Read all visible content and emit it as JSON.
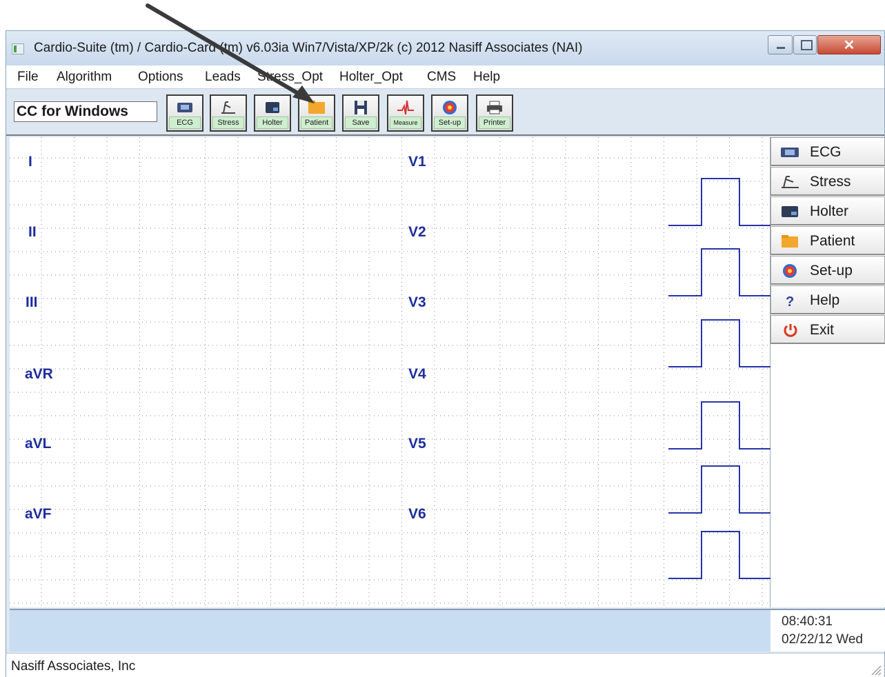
{
  "window": {
    "title": "Cardio-Suite (tm) / Cardio-Card (tm) v6.03ia Win7/Vista/XP/2k (c) 2012 Nasiff Associates (NAI)"
  },
  "menu": [
    "File",
    "Algorithm",
    "Options",
    "Leads",
    "Stress_Opt",
    "Holter_Opt",
    "CMS",
    "Help"
  ],
  "toolbar": {
    "app_name": "CC for Windows",
    "buttons": [
      {
        "label": "ECG",
        "icon": "ecg-icon"
      },
      {
        "label": "Stress",
        "icon": "treadmill-icon"
      },
      {
        "label": "Holter",
        "icon": "holter-icon"
      },
      {
        "label": "Patient",
        "icon": "folder-icon"
      },
      {
        "label": "Save",
        "icon": "floppy-disk-icon"
      },
      {
        "label": "Measure",
        "icon": "measure-waveform-icon"
      },
      {
        "label": "Set-up",
        "icon": "setup-disc-icon"
      },
      {
        "label": "Printer",
        "icon": "printer-icon"
      }
    ]
  },
  "leads": {
    "left": [
      "I",
      "II",
      "III",
      "aVR",
      "aVL",
      "aVF"
    ],
    "right": [
      "V1",
      "V2",
      "V3",
      "V4",
      "V5",
      "V6"
    ]
  },
  "side_menu": [
    {
      "label": "ECG",
      "icon": "ecg-icon"
    },
    {
      "label": "Stress",
      "icon": "treadmill-icon"
    },
    {
      "label": "Holter",
      "icon": "holter-icon"
    },
    {
      "label": "Patient",
      "icon": "folder-icon"
    },
    {
      "label": "Set-up",
      "icon": "setup-disc-icon"
    },
    {
      "label": "Help",
      "icon": "question-mark-icon"
    },
    {
      "label": "Exit",
      "icon": "power-icon"
    }
  ],
  "status": {
    "time": "08:40:31",
    "date": "02/22/12 Wed",
    "company": "Nasiff Associates, Inc"
  },
  "colors": {
    "lead_label": "#1d2d9c",
    "calibration_pulse": "#2633a8",
    "grid_dots": "#8a8a8a",
    "status_band": "#c8dcf2",
    "annotation_arrow": "#3a3a3a"
  }
}
